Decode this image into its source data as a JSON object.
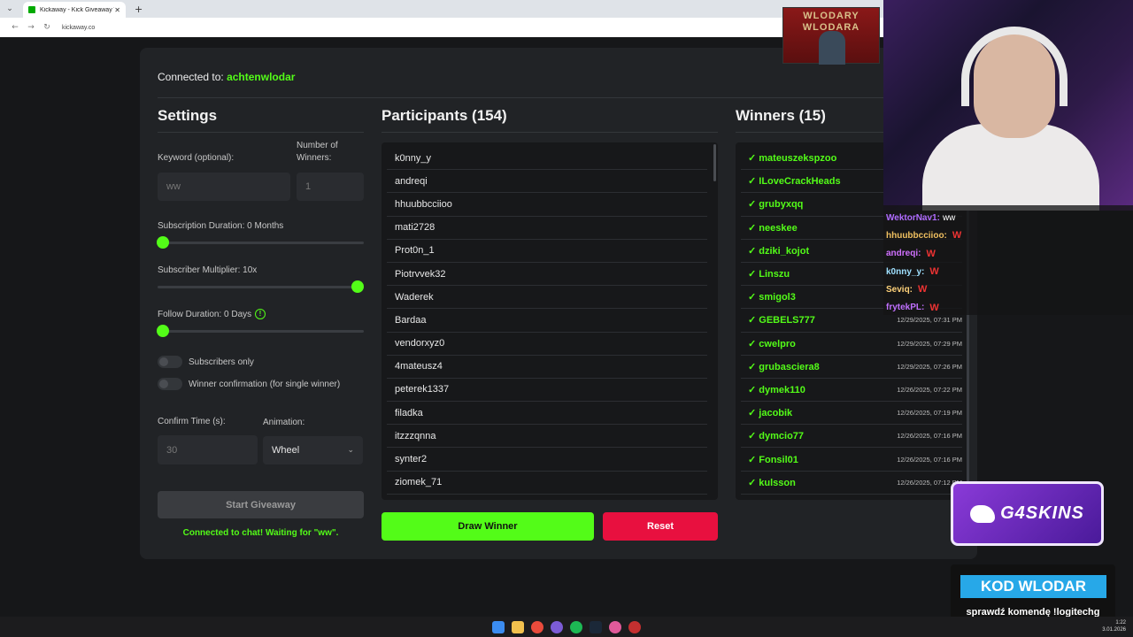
{
  "browser": {
    "tab_title": "Kickaway - Kick Giveaway Tool",
    "url": "kickaway.co"
  },
  "header": {
    "connected_label": "Connected to:",
    "channel": "achtenwlodar"
  },
  "settings": {
    "title": "Settings",
    "keyword_label": "Keyword (optional):",
    "keyword_value": "ww",
    "winners_label_1": "Number of",
    "winners_label_2": "Winners:",
    "winners_value": "1",
    "sub_duration_label": "Subscription Duration: 0 Months",
    "sub_duration_value": 0,
    "sub_multiplier_label": "Subscriber Multiplier: 10x",
    "sub_multiplier_value": 10,
    "follow_duration_label": "Follow Duration: 0 Days",
    "follow_duration_value": 0,
    "subscribers_only_label": "Subscribers only",
    "subscribers_only": false,
    "winner_confirmation_label": "Winner confirmation (for single winner)",
    "winner_confirmation": false,
    "confirm_time_label": "Confirm Time (s):",
    "confirm_time_value": "30",
    "animation_label": "Animation:",
    "animation_value": "Wheel",
    "start_button": "Start Giveaway",
    "status": "Connected to chat! Waiting for \"ww\"."
  },
  "participants": {
    "title": "Participants (154)",
    "items": [
      "k0nny_y",
      "andreqi",
      "hhuubbcciioo",
      "mati2728",
      "Prot0n_1",
      "Piotrvvek32",
      "Waderek",
      "Bardaa",
      "vendorxyz0",
      "4mateusz4",
      "peterek1337",
      "filadka",
      "itzzzqnna",
      "synter2",
      "ziomek_71"
    ],
    "draw_button": "Draw Winner",
    "reset_button": "Reset"
  },
  "winners": {
    "title": "Winners (15)",
    "items": [
      {
        "name": "✓ mateuszekspzoo",
        "date": ""
      },
      {
        "name": "✓ ILoveCrackHeads",
        "date": ""
      },
      {
        "name": "✓ grubyxqq",
        "date": ""
      },
      {
        "name": "✓ neeskee",
        "date": ""
      },
      {
        "name": "✓ dziki_kojot",
        "date": ""
      },
      {
        "name": "✓ Linszu",
        "date": ""
      },
      {
        "name": "✓ smigol3",
        "date": ""
      },
      {
        "name": "✓ GEBELS777",
        "date": "12/29/2025, 07:31 PM"
      },
      {
        "name": "✓ cwelpro",
        "date": "12/29/2025, 07:29 PM"
      },
      {
        "name": "✓ grubasciera8",
        "date": "12/29/2025, 07:26 PM"
      },
      {
        "name": "✓ dymek110",
        "date": "12/26/2025, 07:22 PM"
      },
      {
        "name": "✓ jacobik",
        "date": "12/26/2025, 07:19 PM"
      },
      {
        "name": "✓ dymcio77",
        "date": "12/26/2025, 07:16 PM"
      },
      {
        "name": "✓ Fonsil01",
        "date": "12/26/2025, 07:16 PM"
      },
      {
        "name": "✓ kulsson",
        "date": "12/26/2025, 07:12 PM"
      }
    ]
  },
  "stream_chat": [
    {
      "user": "WektorNav1:",
      "msg": "ww",
      "color": "#b06cff"
    },
    {
      "user": "hhuubbcciioo:",
      "msg": "W",
      "color": "#f0c060"
    },
    {
      "user": "andreqi:",
      "msg": "W",
      "color": "#d070ff"
    },
    {
      "user": "k0nny_y:",
      "msg": "W",
      "color": "#9fe0ff"
    },
    {
      "user": "Seviq:",
      "msg": "W",
      "color": "#ffd27a"
    },
    {
      "user": "frytekPL:",
      "msg": "W",
      "color": "#c070ff"
    }
  ],
  "overlays": {
    "poster_line1": "WLODARY",
    "poster_line2": "WLODARA",
    "sponsor": "G4SKINS",
    "code_title": "KOD WLODAR",
    "code_sub": "sprawdź komendę !logitechg"
  },
  "clock": {
    "time": "1:22",
    "date": "3.01.2026"
  },
  "colors": {
    "accent": "#53fc18",
    "reset": "#e8103f",
    "panel": "#212326"
  }
}
